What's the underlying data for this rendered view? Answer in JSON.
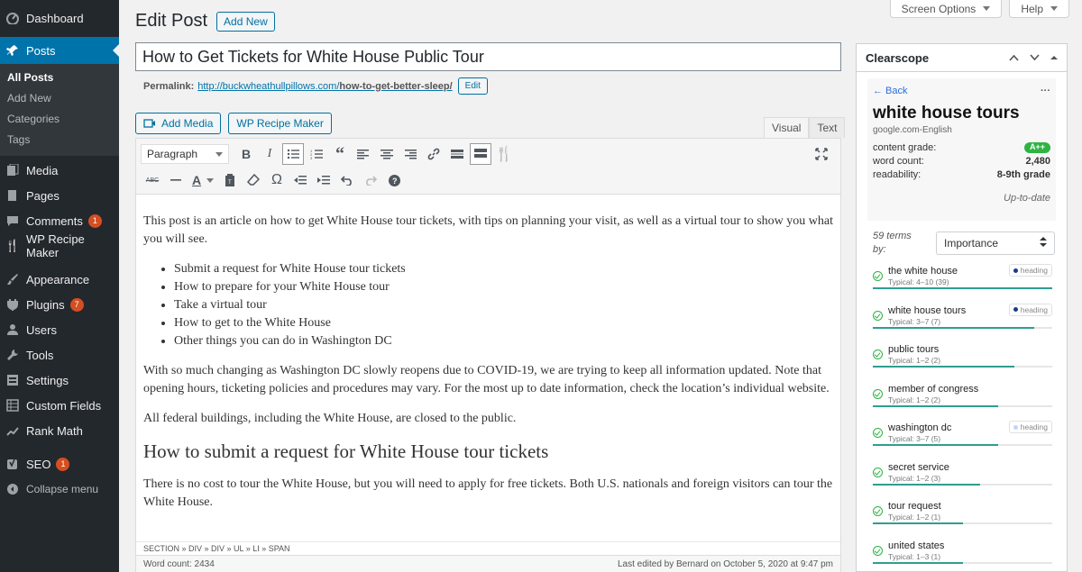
{
  "sidebar": {
    "items": [
      {
        "label": "Dashboard",
        "icon": "dashboard-icon"
      },
      {
        "label": "Posts",
        "icon": "pin-icon"
      },
      {
        "label": "Media",
        "icon": "media-icon"
      },
      {
        "label": "Pages",
        "icon": "pages-icon"
      },
      {
        "label": "Comments",
        "icon": "comment-icon",
        "badge": "1"
      },
      {
        "label": "WP Recipe Maker",
        "icon": "fork-knife-icon"
      },
      {
        "label": "Appearance",
        "icon": "brush-icon"
      },
      {
        "label": "Plugins",
        "icon": "plugin-icon",
        "badge": "7"
      },
      {
        "label": "Users",
        "icon": "user-icon"
      },
      {
        "label": "Tools",
        "icon": "wrench-icon"
      },
      {
        "label": "Settings",
        "icon": "settings-icon"
      },
      {
        "label": "Custom Fields",
        "icon": "grid-icon"
      },
      {
        "label": "Rank Math",
        "icon": "chart-icon"
      },
      {
        "label": "SEO",
        "icon": "yoast-icon",
        "badge": "1"
      },
      {
        "label": "Collapse menu",
        "icon": "collapse-icon"
      }
    ],
    "submenu": [
      "All Posts",
      "Add New",
      "Categories",
      "Tags"
    ]
  },
  "top": {
    "screen_options": "Screen Options",
    "help": "Help"
  },
  "page": {
    "title": "Edit Post",
    "add_new": "Add New"
  },
  "post": {
    "title": "How to Get Tickets for White House Public Tour",
    "permalink_label": "Permalink:",
    "permalink_base": "http://buckwheathullpillows.com/",
    "permalink_slug": "how-to-get-better-sleep/",
    "permalink_edit": "Edit"
  },
  "editor": {
    "add_media": "Add Media",
    "recipe_maker": "WP Recipe Maker",
    "tab_visual": "Visual",
    "tab_text": "Text",
    "format": "Paragraph",
    "content": {
      "intro": "This post is an article on how to get White House tour tickets, with tips on planning your visit, as well as a virtual tour to show you what you will see.",
      "list": [
        "Submit a request for White House tour tickets",
        "How to prepare for your White House tour",
        "Take a virtual tour",
        "How to get to the White House",
        "Other things you can do in Washington DC"
      ],
      "p2": "With so much changing as Washington DC slowly reopens due to COVID-19, we are trying to keep all information updated. Note that opening hours, ticketing policies and procedures may vary. For the most up to date information, check the location’s individual website.",
      "p3": "All federal buildings, including the White House, are closed to the public.",
      "h2": "How to submit a request for White House tour tickets",
      "p4": "There is no cost to tour the White House, but you will need to apply for free tickets. Both U.S. nationals and foreign visitors can tour the White House."
    },
    "path": "SECTION » DIV » DIV » UL » LI » SPAN",
    "word_count": "Word count: 2434",
    "last_edited": "Last edited by Bernard on October 5, 2020 at 9:47 pm"
  },
  "clearscope": {
    "title": "Clearscope",
    "back": "← Back",
    "more": "···",
    "keyword": "white house tours",
    "db": "google.com-English",
    "content_grade_label": "content grade:",
    "content_grade": "A++",
    "word_count_label": "word count:",
    "word_count": "2,480",
    "readability_label": "readability:",
    "readability": "8-9th grade",
    "status": "Up-to-date",
    "terms_count": "59 terms by:",
    "sort": "Importance",
    "accent": "#2fb344",
    "terms": [
      {
        "name": "the white house",
        "typical": "Typical: 4–10 (39)",
        "tag": "heading",
        "fill": 1.0
      },
      {
        "name": "white house tours",
        "typical": "Typical: 3–7 (7)",
        "tag": "heading",
        "fill": 0.9
      },
      {
        "name": "public tours",
        "typical": "Typical: 1–2 (2)",
        "tag": "",
        "fill": 0.79
      },
      {
        "name": "member of congress",
        "typical": "Typical: 1–2 (2)",
        "tag": "",
        "fill": 0.7
      },
      {
        "name": "washington dc",
        "typical": "Typical: 3–7 (5)",
        "tag": "heading",
        "tag_light": true,
        "fill": 0.7
      },
      {
        "name": "secret service",
        "typical": "Typical: 1–2 (3)",
        "tag": "",
        "fill": 0.6
      },
      {
        "name": "tour request",
        "typical": "Typical: 1–2 (1)",
        "tag": "",
        "fill": 0.5
      },
      {
        "name": "united states",
        "typical": "Typical: 1–3 (1)",
        "tag": "",
        "fill": 0.5
      }
    ]
  }
}
